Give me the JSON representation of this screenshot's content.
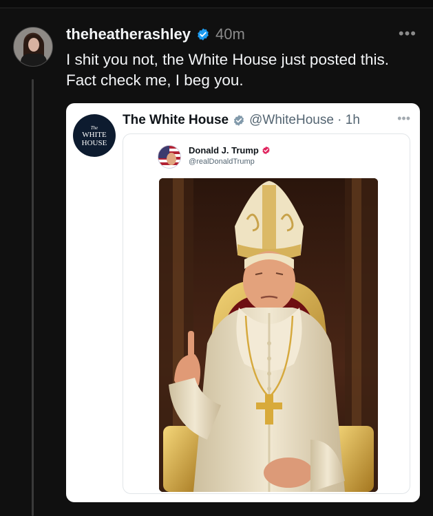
{
  "post": {
    "username": "theheatherashley",
    "time": "40m",
    "text": "I shit you not, the White House just posted this. Fact check me, I beg you.",
    "more": "•••"
  },
  "quoted": {
    "logo_small": "The",
    "logo_big": "WHITE HOUSE",
    "name": "The White House",
    "handle": "@WhiteHouse · 1h",
    "more": "•••",
    "inner": {
      "name": "Donald J. Trump",
      "handle": "@realDonaldTrump"
    }
  },
  "colors": {
    "verified": "#1d9bf0",
    "gold_verified": "#c7a34a",
    "pink_verified": "#e0245e"
  },
  "icons": [
    "verified-badge-icon",
    "more-icon",
    "verified-badge-icon",
    "verified-badge-icon"
  ]
}
